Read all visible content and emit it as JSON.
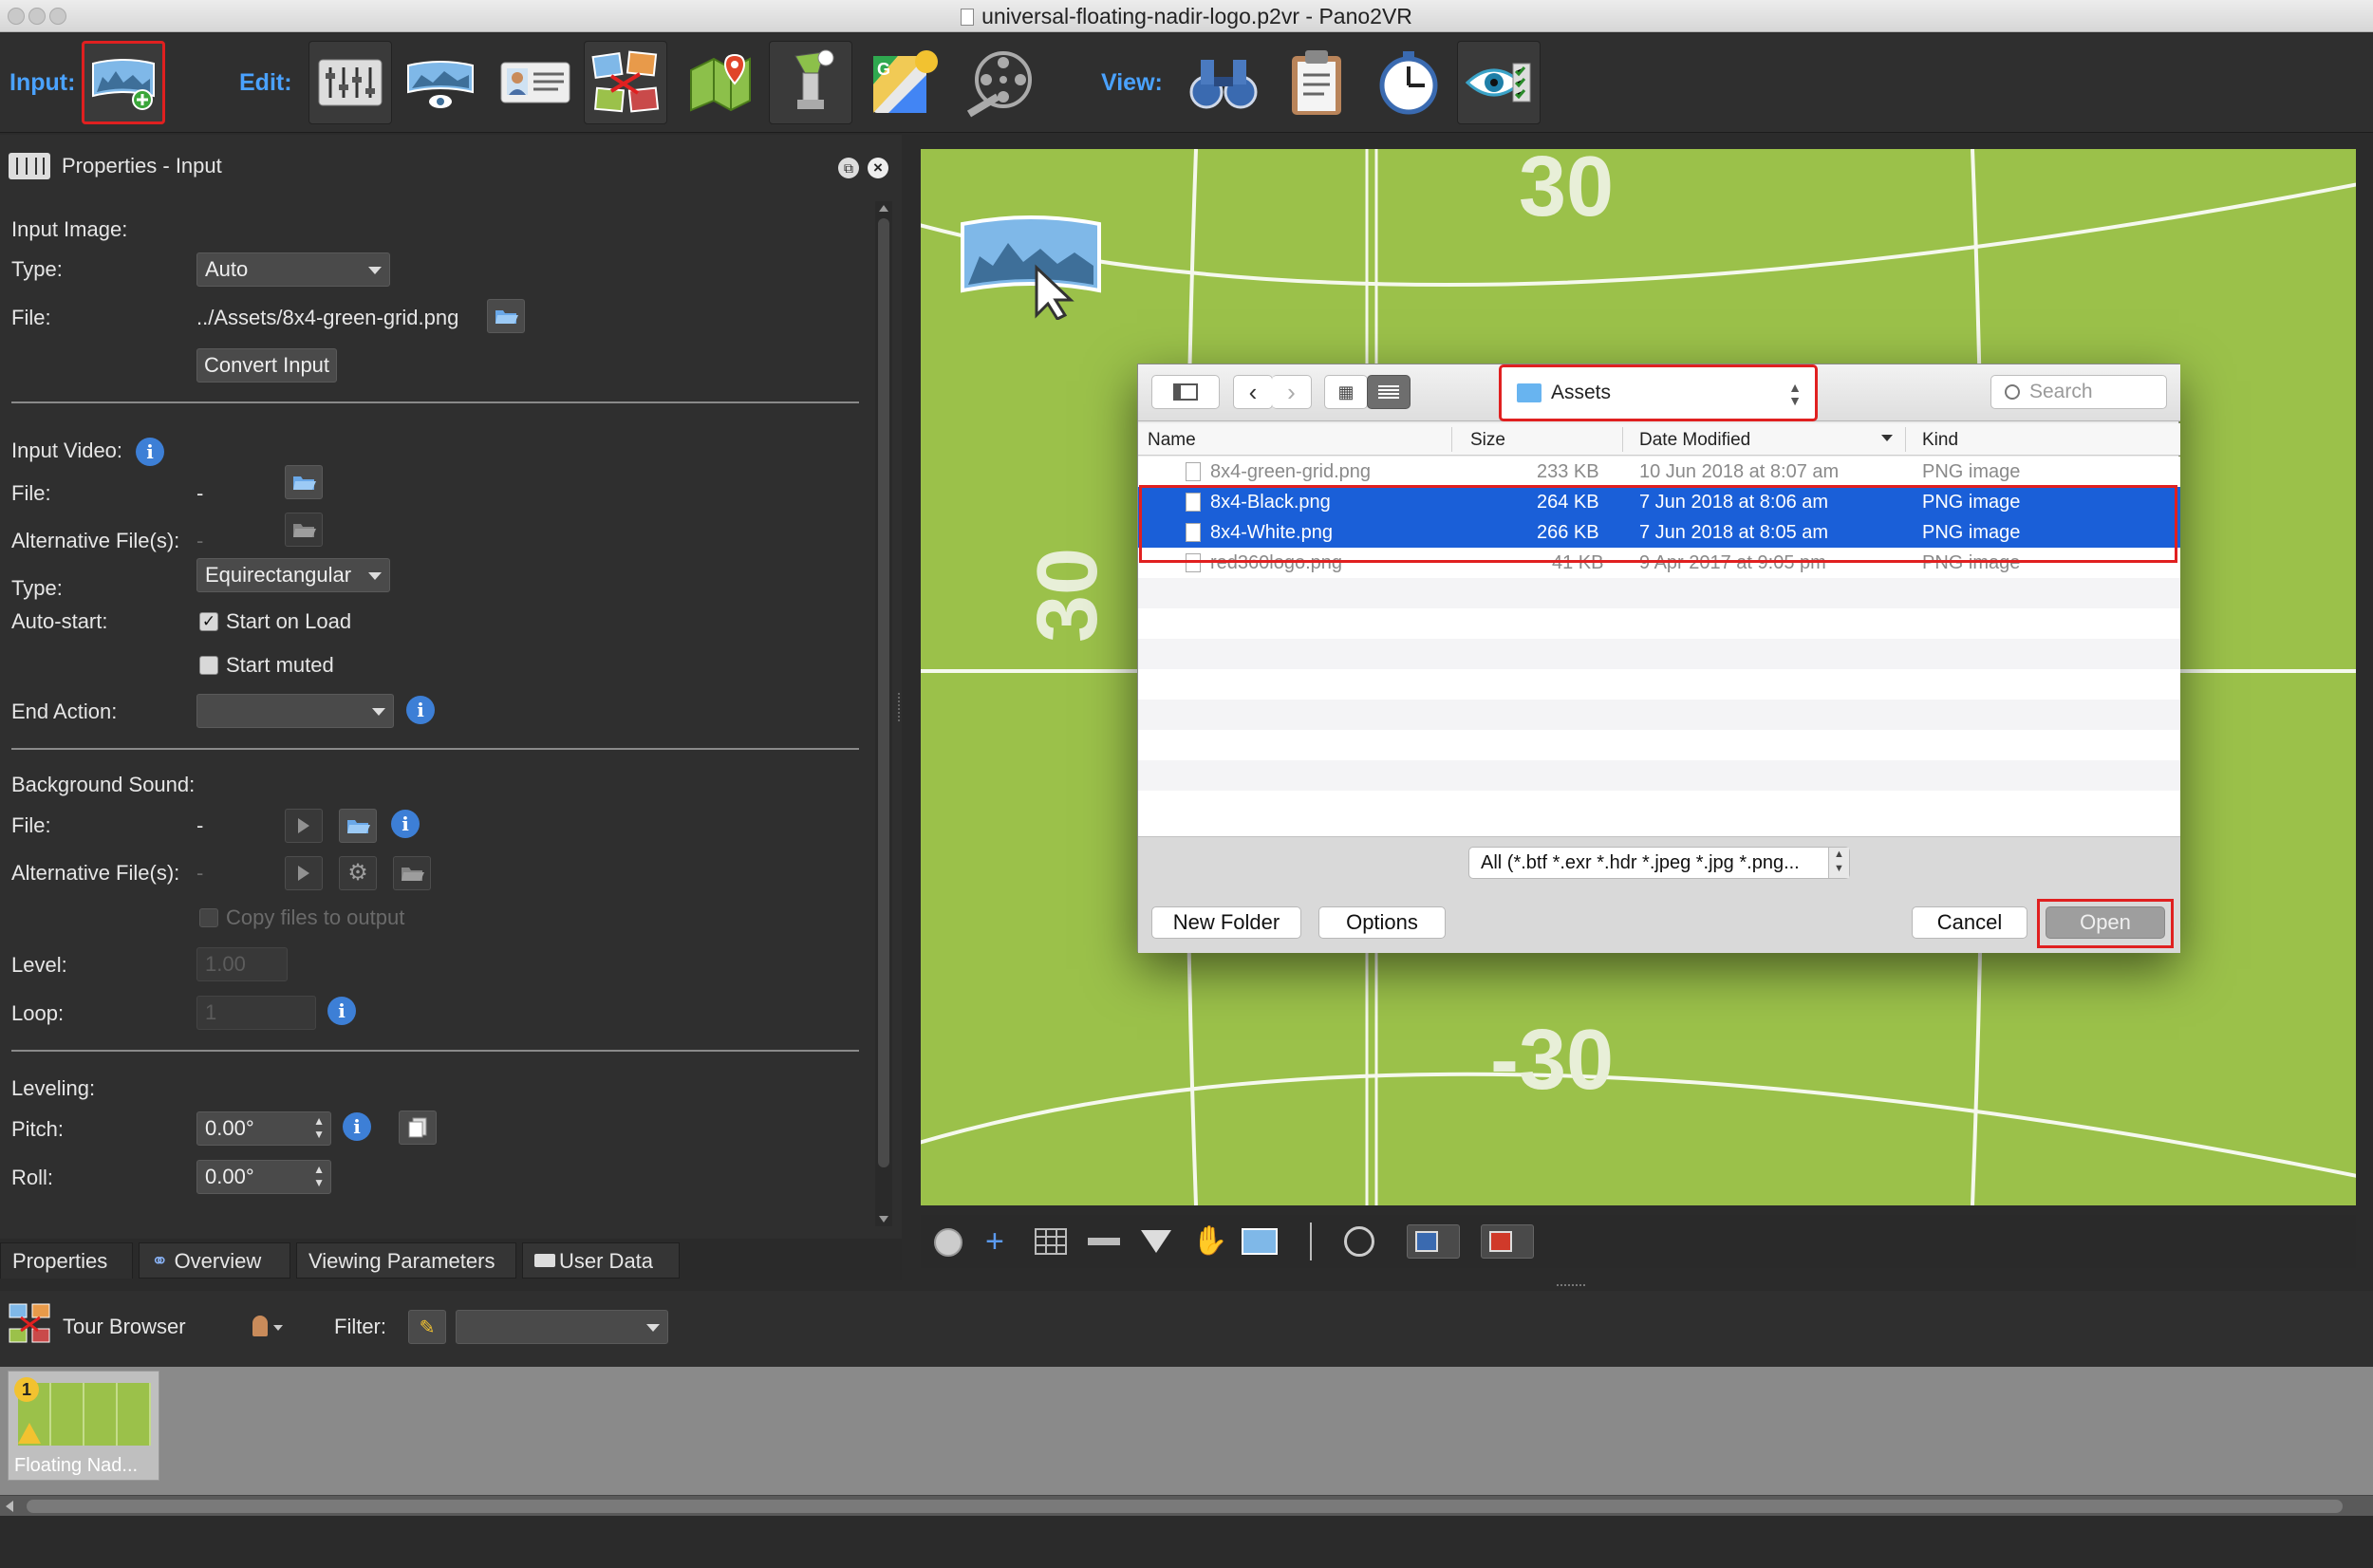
{
  "window": {
    "title": "universal-floating-nadir-logo.p2vr - Pano2VR"
  },
  "toolbar": {
    "input_label": "Input:",
    "edit_label": "Edit:",
    "view_label": "View:",
    "input_tools": [
      {
        "icon": "add-panorama-icon"
      }
    ],
    "edit_tools": [
      {
        "icon": "sliders-icon"
      },
      {
        "icon": "viewing-parameters-icon"
      },
      {
        "icon": "user-data-icon"
      },
      {
        "icon": "tour-map-icon"
      },
      {
        "icon": "map-marker-icon"
      },
      {
        "icon": "patch-input-icon"
      },
      {
        "icon": "google-maps-icon"
      },
      {
        "icon": "animation-film-icon"
      }
    ],
    "view_tools": [
      {
        "icon": "binoculars-icon"
      },
      {
        "icon": "clipboard-icon"
      },
      {
        "icon": "stopwatch-icon"
      },
      {
        "icon": "eye-checklist-icon"
      }
    ]
  },
  "properties": {
    "title": "Properties - Input",
    "input_image": {
      "section": "Input Image:",
      "type_label": "Type:",
      "type_value": "Auto",
      "file_label": "File:",
      "file_value": "../Assets/8x4-green-grid.png",
      "convert_button": "Convert Input"
    },
    "input_video": {
      "section": "Input Video:",
      "file_label": "File:",
      "file_value": "-",
      "alt_label": "Alternative File(s):",
      "alt_value": "-",
      "type_label": "Type:",
      "type_value": "Equirectangular",
      "autostart_label": "Auto-start:",
      "start_on_load": "Start on Load",
      "start_on_load_checked": true,
      "start_muted": "Start muted",
      "start_muted_checked": false,
      "end_action_label": "End Action:",
      "end_action_value": ""
    },
    "background_sound": {
      "section": "Background Sound:",
      "file_label": "File:",
      "file_value": "-",
      "alt_label": "Alternative File(s):",
      "alt_value": "-",
      "copy_files": "Copy files to output",
      "level_label": "Level:",
      "level_value": "1.00",
      "loop_label": "Loop:",
      "loop_value": "1"
    },
    "leveling": {
      "section": "Leveling:",
      "pitch_label": "Pitch:",
      "pitch_value": "0.00°",
      "roll_label": "Roll:",
      "roll_value": "0.00°"
    },
    "tabs": [
      "Properties",
      "Overview",
      "Viewing Parameters",
      "User Data"
    ],
    "active_tab": "Properties"
  },
  "tour_browser": {
    "title": "Tour Browser",
    "filter_label": "Filter:",
    "filter_value": "",
    "items": [
      {
        "label": "Floating Nad...",
        "badge": "1"
      }
    ]
  },
  "viewer": {
    "grid_labels": [
      "30",
      "30",
      "-30"
    ],
    "background_color": "#9bc14a"
  },
  "dialog": {
    "location": "Assets",
    "search_placeholder": "Search",
    "columns": [
      "Name",
      "Size",
      "Date Modified",
      "Kind"
    ],
    "files": [
      {
        "name": "8x4-green-grid.png",
        "size": "233 KB",
        "date": "10 Jun 2018 at 8:07 am",
        "kind": "PNG image",
        "state": "ghost"
      },
      {
        "name": "8x4-Black.png",
        "size": "264 KB",
        "date": "7 Jun 2018 at 8:06 am",
        "kind": "PNG image",
        "state": "selected"
      },
      {
        "name": "8x4-White.png",
        "size": "266 KB",
        "date": "7 Jun 2018 at 8:05 am",
        "kind": "PNG image",
        "state": "selected"
      },
      {
        "name": "red360logo.png",
        "size": "41 KB",
        "date": "9 Apr 2017 at 9:05 pm",
        "kind": "PNG image",
        "state": "ghost"
      }
    ],
    "file_type_filter": "All (*.btf *.exr *.hdr *.jpeg *.jpg *.png...",
    "new_folder": "New Folder",
    "options": "Options",
    "cancel": "Cancel",
    "open": "Open"
  },
  "colors": {
    "accent": "#4aa2ff",
    "selection": "#1a5fd8",
    "highlight": "#e02020"
  }
}
